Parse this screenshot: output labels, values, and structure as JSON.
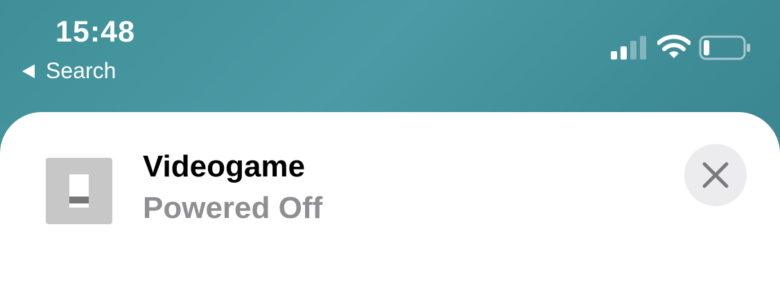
{
  "status_bar": {
    "time": "15:48",
    "back_label": "Search",
    "icons": [
      "cellular-signal-icon",
      "wifi-icon",
      "battery-icon"
    ],
    "battery_level": 0.15
  },
  "accessory": {
    "name": "Videogame",
    "state": "Powered Off",
    "icon": "switch-icon",
    "close_icon": "close-icon"
  },
  "colors": {
    "header_bg": "#4598a2",
    "sheet_bg": "#ffffff",
    "title_text": "#000000",
    "secondary_text": "#8e8e93",
    "tile_bg": "#c7c7c7",
    "close_bg": "#ececee"
  }
}
